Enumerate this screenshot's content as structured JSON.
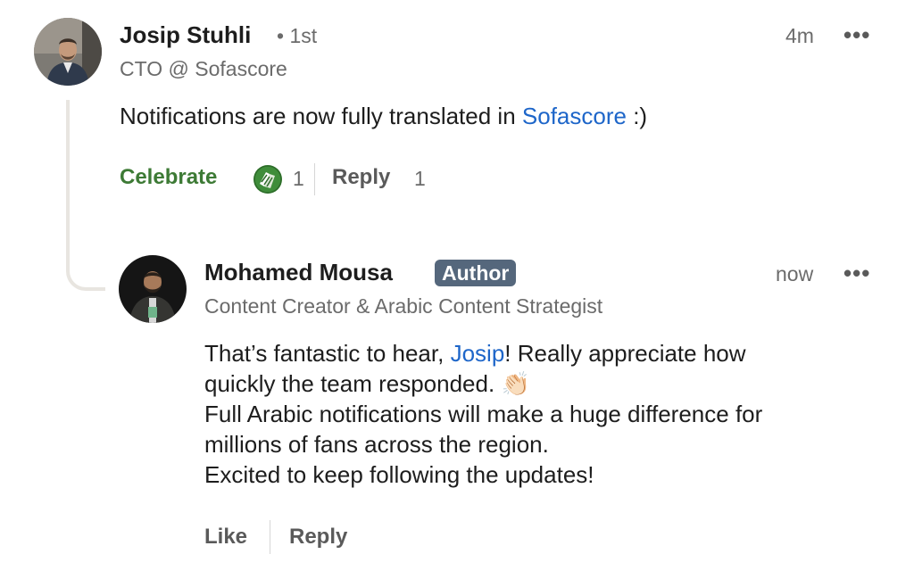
{
  "comment": {
    "author": "Josip Stuhli",
    "degree_sep": "•",
    "degree": "1st",
    "headline": "CTO @ Sofascore",
    "time": "4m",
    "more": "•••",
    "text_prefix": "Notifications are now fully translated in ",
    "text_mention": "Sofascore",
    "text_suffix": " :)",
    "reaction_label": "Celebrate",
    "reaction_icon": "celebrate-hands-icon",
    "reaction_count": "1",
    "reply_label": "Reply",
    "reply_count": "1"
  },
  "reply": {
    "author": "Mohamed Mousa",
    "badge": "Author",
    "headline": "Content Creator & Arabic Content Strategist",
    "time": "now",
    "more": "•••",
    "line1_prefix": "That’s fantastic to hear, ",
    "line1_mention": "Josip",
    "line1_suffix": "! Really appreciate how",
    "line2": "quickly the team responded.",
    "line2_emoji": "👏🏻",
    "line3": "Full Arabic notifications will make a huge difference for",
    "line4": "millions of fans across the region.",
    "line5": "Excited to keep following the updates!",
    "like_label": "Like",
    "reply_label": "Reply"
  },
  "colors": {
    "link": "#1e66c9",
    "celebrate": "#3d7a35",
    "badge_bg": "#55677c"
  }
}
